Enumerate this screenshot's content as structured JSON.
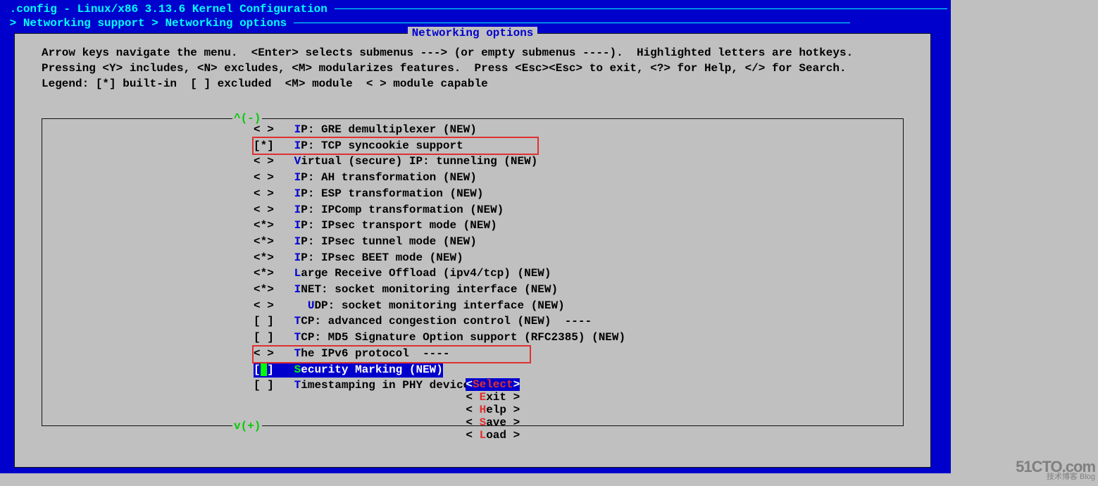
{
  "header": {
    "title_prefix": ".config - ",
    "title": "Linux/x86 3.13.6 Kernel Configuration",
    "breadcrumb": "> Networking support > Networking options"
  },
  "dialog": {
    "title": "Networking options",
    "help_text": "Arrow keys navigate the menu.  <Enter> selects submenus ---> (or empty submenus ----).  Highlighted letters are hotkeys.  Pressing <Y> includes, <N> excludes, <M> modularizes features.  Press <Esc><Esc> to exit, <?> for Help, </> for Search.  Legend: [*] built-in  [ ] excluded  <M> module  < > module capable",
    "scroll_top": "^(-)",
    "scroll_bot": "v(+)"
  },
  "options": [
    {
      "bracket": "< >",
      "hotkey": "I",
      "rest": "P: GRE demultiplexer (NEW)"
    },
    {
      "bracket": "[*]",
      "hotkey": "I",
      "rest": "P: TCP syncookie support"
    },
    {
      "bracket": "< >",
      "hotkey": "V",
      "rest": "irtual (secure) IP: tunneling (NEW)"
    },
    {
      "bracket": "< >",
      "hotkey": "I",
      "rest": "P: AH transformation (NEW)"
    },
    {
      "bracket": "< >",
      "hotkey": "I",
      "rest": "P: ESP transformation (NEW)"
    },
    {
      "bracket": "< >",
      "hotkey": "I",
      "rest": "P: IPComp transformation (NEW)"
    },
    {
      "bracket": "<*>",
      "hotkey": "I",
      "rest": "P: IPsec transport mode (NEW)"
    },
    {
      "bracket": "<*>",
      "hotkey": "I",
      "rest": "P: IPsec tunnel mode (NEW)"
    },
    {
      "bracket": "<*>",
      "hotkey": "I",
      "rest": "P: IPsec BEET mode (NEW)"
    },
    {
      "bracket": "<*>",
      "hotkey": "L",
      "rest": "arge Receive Offload (ipv4/tcp) (NEW)"
    },
    {
      "bracket": "<*>",
      "hotkey": "I",
      "rest": "NET: socket monitoring interface (NEW)"
    },
    {
      "bracket": "< >",
      "hotkey": "U",
      "rest": "DP: socket monitoring interface (NEW)",
      "indent": "  "
    },
    {
      "bracket": "[ ]",
      "hotkey": "T",
      "rest": "CP: advanced congestion control (NEW)  ----"
    },
    {
      "bracket": "[ ]",
      "hotkey": "T",
      "rest": "CP: MD5 Signature Option support (RFC2385) (NEW)"
    },
    {
      "bracket": "< >",
      "hotkey": "T",
      "rest": "he IPv6 protocol  ----"
    },
    {
      "bracket": "[ ]",
      "hotkey": "S",
      "rest": "ecurity Marking (NEW)",
      "selected": true
    },
    {
      "bracket": "[ ]",
      "hotkey": "T",
      "rest": "imestamping in PHY devices (NEW)"
    }
  ],
  "buttons": {
    "select": "Select",
    "exit": "Exit",
    "help": "Help",
    "save": "Save",
    "load": "Load"
  },
  "watermark": {
    "line1": "51CTO.com",
    "line2": "技术博客     Blog"
  }
}
